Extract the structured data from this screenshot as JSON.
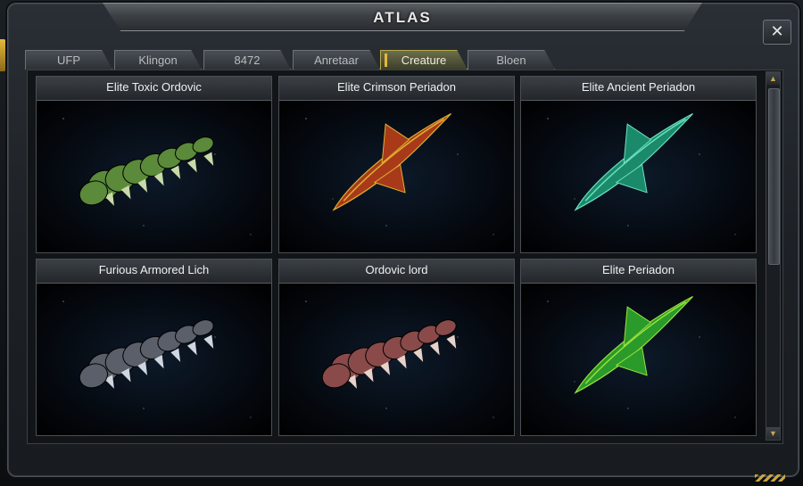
{
  "window": {
    "title": "ATLAS",
    "close_label": "✕"
  },
  "tabs": [
    {
      "label": "UFP",
      "active": false
    },
    {
      "label": "Klingon",
      "active": false
    },
    {
      "label": "8472",
      "active": false
    },
    {
      "label": "Anretaar",
      "active": false
    },
    {
      "label": "Creature",
      "active": true
    },
    {
      "label": "Bloen",
      "active": false
    }
  ],
  "cards": [
    {
      "name": "Elite Toxic Ordovic",
      "creature": "worm",
      "color": "#5a8a3a",
      "accent": "#c9d9a8"
    },
    {
      "name": "Elite Crimson Periadon",
      "creature": "ship",
      "color": "#a83a1a",
      "accent": "#e0b030"
    },
    {
      "name": "Elite Ancient Periadon",
      "creature": "ship",
      "color": "#1a8a6a",
      "accent": "#6ae0c0"
    },
    {
      "name": "Furious  Armored Lich",
      "creature": "worm",
      "color": "#5a5f6a",
      "accent": "#cfd6e0"
    },
    {
      "name": "Ordovic lord",
      "creature": "worm",
      "color": "#8a4a4a",
      "accent": "#e6d2c8"
    },
    {
      "name": "Elite Periadon",
      "creature": "ship",
      "color": "#2a9a2a",
      "accent": "#9ae03a"
    }
  ],
  "icons": {
    "close": "close-icon",
    "scroll_up": "arrow-up-icon",
    "scroll_down": "arrow-down-icon"
  }
}
